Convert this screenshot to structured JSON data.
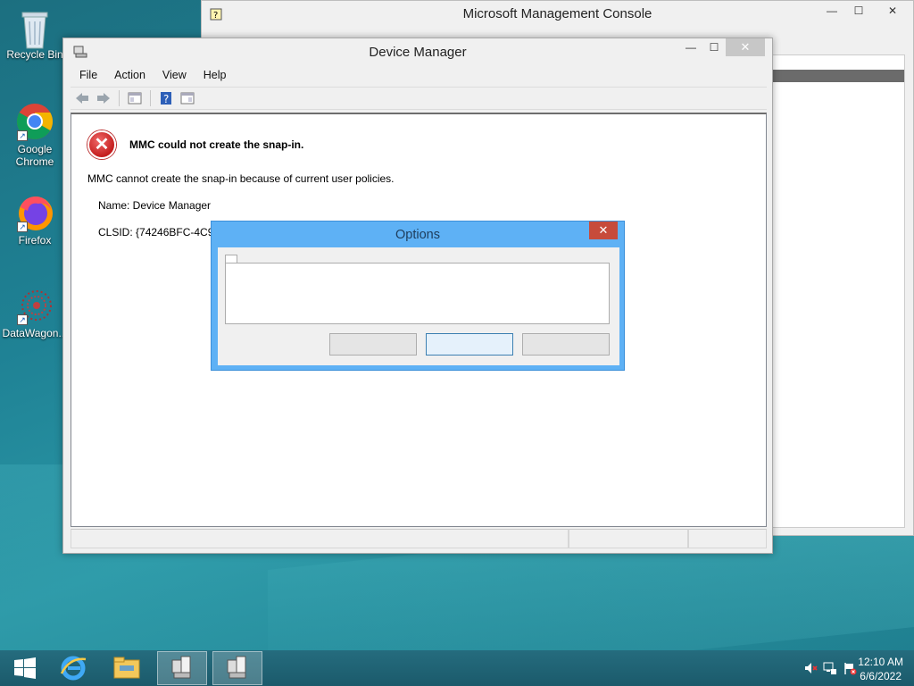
{
  "desktop": {
    "icons": [
      {
        "label": "Recycle Bin",
        "icon": "recycle-bin-icon"
      },
      {
        "label": "Google Chrome",
        "icon": "chrome-icon"
      },
      {
        "label": "Firefox",
        "icon": "firefox-icon"
      },
      {
        "label": "DataWagon...",
        "icon": "datawagon-icon"
      }
    ]
  },
  "mmc_window": {
    "title": "Microsoft Management Console",
    "icon": "mmc-icon"
  },
  "device_manager": {
    "title": "Device Manager",
    "close_glyph": "✕",
    "menu": [
      "File",
      "Action",
      "View",
      "Help"
    ],
    "error_title": "MMC could not create the snap-in.",
    "message": "MMC cannot create the snap-in because of current user policies.",
    "name_line": "Name: Device Manager",
    "clsid_line": "CLSID: {74246BFC-4C96-"
  },
  "options_dialog": {
    "title": "Options",
    "close_glyph": "✕"
  },
  "taskbar": {
    "time": "12:10 AM",
    "date": "6/6/2022"
  },
  "colors": {
    "dialog_title_bg": "#5eb1f5",
    "dialog_close_bg": "#c74b3b",
    "taskbar_bg": "#1d5e70"
  }
}
